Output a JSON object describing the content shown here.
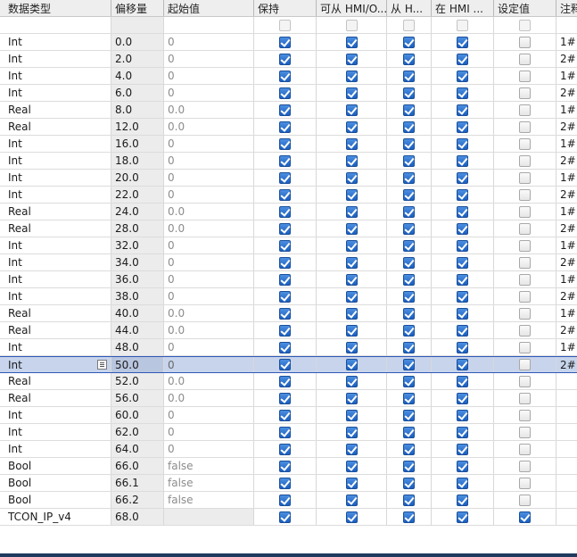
{
  "header": {
    "data_type": "数据类型",
    "offset": "偏移量",
    "start_value": "起始值",
    "retain": "保持",
    "hmi_accessible": "可从 HMI/O...",
    "hmi_writable": "从 H...",
    "hmi_visible": "在 HMI ...",
    "setpoint": "设定值",
    "comment": "注释"
  },
  "rows": [
    {
      "type": "Int",
      "offset": "0.0",
      "start": "0",
      "comment": "1#"
    },
    {
      "type": "Int",
      "offset": "2.0",
      "start": "0",
      "comment": "2#"
    },
    {
      "type": "Int",
      "offset": "4.0",
      "start": "0",
      "comment": "1#"
    },
    {
      "type": "Int",
      "offset": "6.0",
      "start": "0",
      "comment": "2#"
    },
    {
      "type": "Real",
      "offset": "8.0",
      "start": "0.0",
      "comment": "1#"
    },
    {
      "type": "Real",
      "offset": "12.0",
      "start": "0.0",
      "comment": "2#"
    },
    {
      "type": "Int",
      "offset": "16.0",
      "start": "0",
      "comment": "1#"
    },
    {
      "type": "Int",
      "offset": "18.0",
      "start": "0",
      "comment": "2#"
    },
    {
      "type": "Int",
      "offset": "20.0",
      "start": "0",
      "comment": "1#"
    },
    {
      "type": "Int",
      "offset": "22.0",
      "start": "0",
      "comment": "2#"
    },
    {
      "type": "Real",
      "offset": "24.0",
      "start": "0.0",
      "comment": "1#"
    },
    {
      "type": "Real",
      "offset": "28.0",
      "start": "0.0",
      "comment": "2#"
    },
    {
      "type": "Int",
      "offset": "32.0",
      "start": "0",
      "comment": "1#"
    },
    {
      "type": "Int",
      "offset": "34.0",
      "start": "0",
      "comment": "2#"
    },
    {
      "type": "Int",
      "offset": "36.0",
      "start": "0",
      "comment": "1#"
    },
    {
      "type": "Int",
      "offset": "38.0",
      "start": "0",
      "comment": "2#"
    },
    {
      "type": "Real",
      "offset": "40.0",
      "start": "0.0",
      "comment": "1#"
    },
    {
      "type": "Real",
      "offset": "44.0",
      "start": "0.0",
      "comment": "2#"
    },
    {
      "type": "Int",
      "offset": "48.0",
      "start": "0",
      "comment": "1#"
    },
    {
      "type": "Int",
      "offset": "50.0",
      "start": "0",
      "comment": "2#",
      "selected": true
    },
    {
      "type": "Real",
      "offset": "52.0",
      "start": "0.0",
      "comment": ""
    },
    {
      "type": "Real",
      "offset": "56.0",
      "start": "0.0",
      "comment": ""
    },
    {
      "type": "Int",
      "offset": "60.0",
      "start": "0",
      "comment": ""
    },
    {
      "type": "Int",
      "offset": "62.0",
      "start": "0",
      "comment": ""
    },
    {
      "type": "Int",
      "offset": "64.0",
      "start": "0",
      "comment": ""
    },
    {
      "type": "Bool",
      "offset": "66.0",
      "start": "false",
      "comment": ""
    },
    {
      "type": "Bool",
      "offset": "66.1",
      "start": "false",
      "comment": ""
    },
    {
      "type": "Bool",
      "offset": "66.2",
      "start": "false",
      "comment": ""
    },
    {
      "type": "TCON_IP_v4",
      "offset": "68.0",
      "start": "",
      "comment": "",
      "setpoint": true,
      "struct": true
    }
  ]
}
